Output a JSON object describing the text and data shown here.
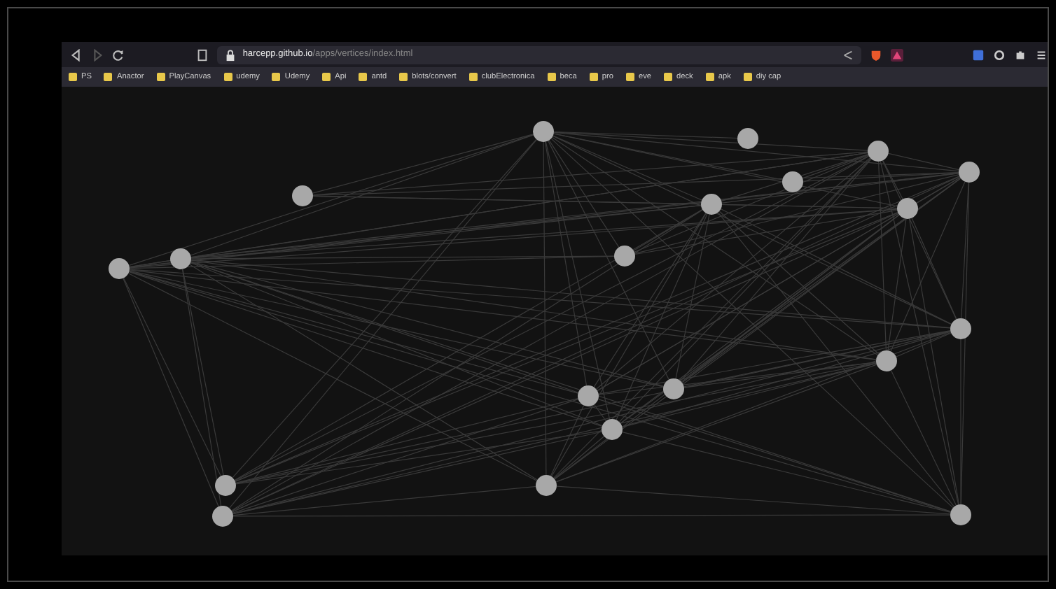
{
  "browser": {
    "url_host": "harcepp.github.io",
    "url_path": "/apps/vertices/index.html",
    "bookmarks": [
      "PS",
      "Anactor",
      "PlayCanvas",
      "udemy",
      "Udemy",
      "Api",
      "antd",
      "blots/convert",
      "clubElectronica",
      "beca",
      "pro",
      "eve",
      "deck",
      "apk",
      "diy cap"
    ]
  }
}
